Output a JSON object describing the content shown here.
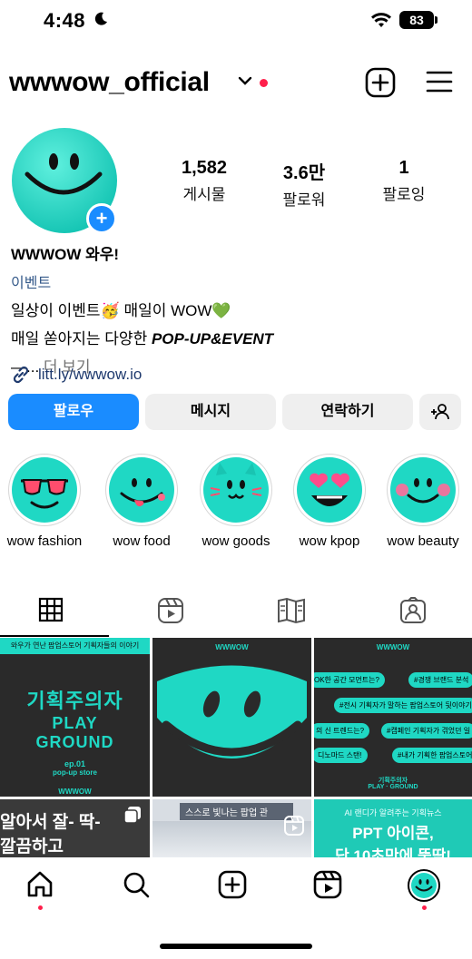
{
  "status": {
    "time": "4:48",
    "battery": "83"
  },
  "header": {
    "username": "wwwow_official"
  },
  "profile": {
    "stats": [
      {
        "value": "1,582",
        "label": "게시물"
      },
      {
        "value": "3.6만",
        "label": "팔로워"
      },
      {
        "value": "1",
        "label": "팔로잉"
      }
    ],
    "name": "WWWOW 와우!",
    "category": "이벤트",
    "bio_line1": "일상이 이벤트🥳 매일이 WOW💚",
    "bio_line2_prefix": "매일 쏟아지는 다양한 ",
    "bio_line2_bold": "POP-UP&EVENT",
    "bio_line3_prefix": "—...",
    "bio_more": " 더 보기",
    "link": "litt.ly/wwwow.io"
  },
  "actions": {
    "follow": "팔로우",
    "message": "메시지",
    "contact": "연락하기"
  },
  "highlights": [
    {
      "label": "wow fashion",
      "icon": "sunglasses-face"
    },
    {
      "label": "wow food",
      "icon": "tongue-face"
    },
    {
      "label": "wow goods",
      "icon": "cat-face"
    },
    {
      "label": "wow kpop",
      "icon": "heart-eyes-face"
    },
    {
      "label": "wow beauty",
      "icon": "blush-face"
    }
  ],
  "grid": {
    "post1": {
      "top_text": "와우가 연난 팝업스토어 기획자들의 이야기",
      "title1": "기획주의자",
      "title2": "PLAY",
      "title3": "GROUND",
      "ep": "ep.01",
      "sub": "pop-up store",
      "brand": "WWWOW"
    },
    "post2": {
      "brand": "WWWOW"
    },
    "post3": {
      "brand": "WWWOW",
      "bubbles": [
        "OK한 공간 모먼트는?",
        "#경쟁 브랜드 분석",
        "#전시 기획자가 말하는 팝업스토어 뒷이야기",
        "의 신 트렌드는?",
        "#캡페인 기획자가 겪었던 일",
        "디노마드 스탠!",
        "#내가 기획한 팝업스토어"
      ],
      "footer1": "기획주의자",
      "footer2": "PLAY · GROUND"
    },
    "post4": {
      "text1": "알아서 잘- 딱-",
      "text2": "깔끔하고"
    },
    "post5": {
      "text": "스스로 빛나는 팝업 관"
    },
    "post6": {
      "top": "AI 랜디가 알려주는 기획뉴스",
      "line1": "PPT 아이콘,",
      "line2": "단 10초만에 뚝딱!"
    }
  },
  "colors": {
    "accent": "#1a8cff",
    "brand_teal": "#1fd8c4",
    "notification": "#ff1f4b"
  }
}
